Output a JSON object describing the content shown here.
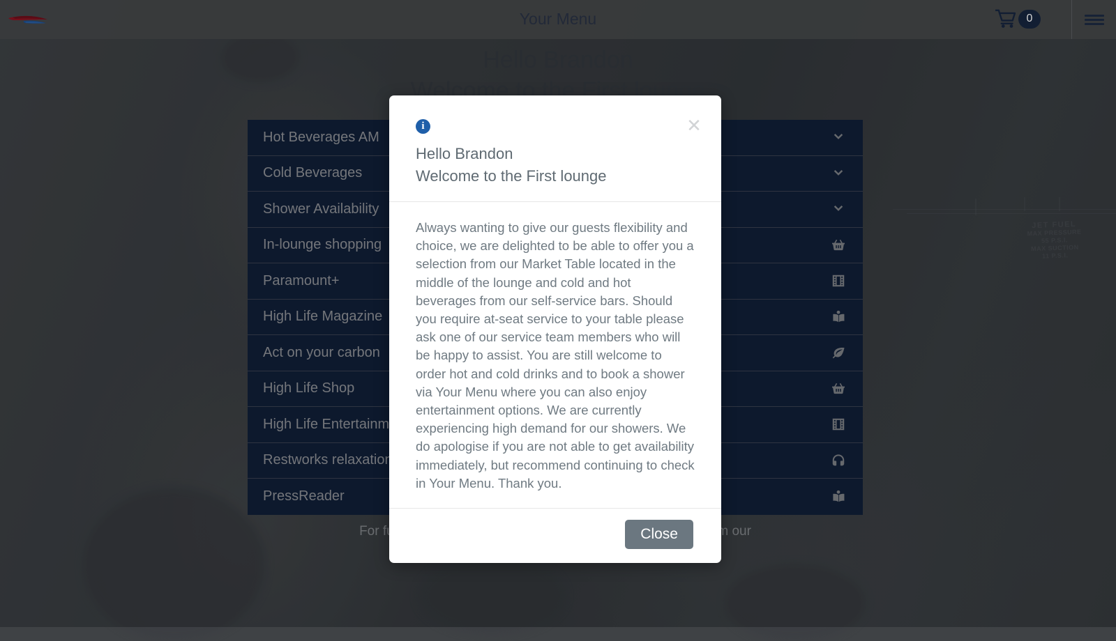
{
  "header": {
    "logo_name": "british-airways-speedmarque-logo",
    "title": "Your Menu",
    "cart_icon": "shopping-cart-icon",
    "cart_count": "0",
    "menu_icon": "hamburger-menu-icon"
  },
  "hero": {
    "line1": "Hello Brandon",
    "line2": "Welcome to the First lounge"
  },
  "menu": {
    "items": [
      {
        "label": "Hot Beverages AM",
        "icon": "chevron-down-icon"
      },
      {
        "label": "Cold Beverages",
        "icon": "chevron-down-icon"
      },
      {
        "label": "Shower Availability",
        "icon": "chevron-down-icon"
      },
      {
        "label": "In-lounge shopping",
        "icon": "shopping-basket-icon"
      },
      {
        "label": "Paramount+",
        "icon": "film-icon"
      },
      {
        "label": "High Life Magazine",
        "icon": "book-reader-icon"
      },
      {
        "label": "Act on your carbon",
        "icon": "leaf-icon"
      },
      {
        "label": "High Life Shop",
        "icon": "shopping-basket-icon"
      },
      {
        "label": "High Life Entertainment",
        "icon": "film-icon"
      },
      {
        "label": "Restworks relaxation",
        "icon": "headphones-icon"
      },
      {
        "label": "PressReader",
        "icon": "book-reader-icon"
      }
    ]
  },
  "footer": {
    "note": "For further information on allergens please seek guidance from our"
  },
  "modal": {
    "info_icon": "info-circle-icon",
    "close_icon": "close-x-icon",
    "title_line1": "Hello Brandon",
    "title_line2": "Welcome to the First lounge",
    "body": "Always wanting to give our guests flexibility and choice, we are delighted to be able to offer you a selection from our Market Table located in the middle of the lounge and cold and hot beverages from our self-service bars. Should you require at-seat service to your table please ask one of our service team members who will be happy to assist. You are still welcome to order hot and cold drinks and to book a shower via Your Menu where you can also enjoy entertainment options. We are currently experiencing high demand for our showers. We do apologise if you are not able to get availability immediately, but recommend continuing to check in Your Menu. Thank you.",
    "close_button": "Close"
  },
  "background": {
    "stencil_title": "JET FUEL",
    "stencil_line1": "MAX PRESSURE",
    "stencil_line2": "55 P.S.I.",
    "stencil_line3": "MAX SUCTION",
    "stencil_line4": "11 P.S.I."
  },
  "colors": {
    "brand_red": "#a41c2e",
    "brand_blue": "#1d4f91",
    "navy_row": "#111f38",
    "info_blue": "#1f5fa9",
    "close_button": "#6b7780"
  }
}
